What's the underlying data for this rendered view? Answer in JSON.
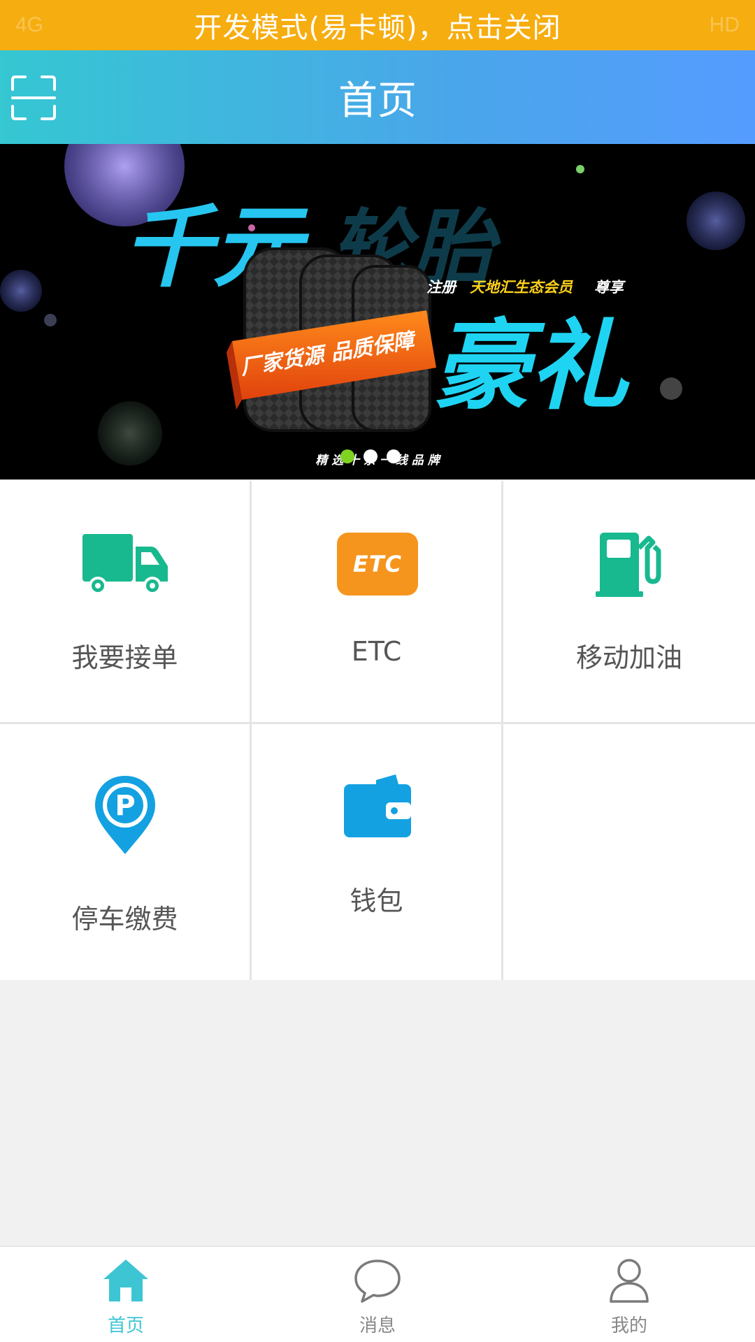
{
  "dev_banner": {
    "message": "开发模式(易卡顿)，点击关闭",
    "status_left": "4G",
    "status_right": "HD"
  },
  "header": {
    "title": "首页",
    "scan_icon": "scan-icon"
  },
  "banner": {
    "headline_a": "千元",
    "headline_b": "轮胎",
    "headline_c": "豪礼",
    "promo_prefix": "注册",
    "promo_highlight": "天地汇生态会员",
    "promo_suffix": "尊享",
    "ribbon_text": "厂家货源  品质保障",
    "footer_text": "精  选  十  余  一  线  品  牌",
    "carousel": {
      "count": 3,
      "active_index": 0,
      "active_color": "#7ed321",
      "dot_color": "#ffffff"
    }
  },
  "services": [
    {
      "label": "我要接单",
      "icon": "truck-icon",
      "color": "#18b98e"
    },
    {
      "label": "ETC",
      "icon": "etc-icon",
      "color": "#f5951d",
      "badge": "ETC"
    },
    {
      "label": "移动加油",
      "icon": "fuel-pump-icon",
      "color": "#18b98e"
    },
    {
      "label": "停车缴费",
      "icon": "parking-pin-icon",
      "color": "#13a1e2",
      "badge": "P"
    },
    {
      "label": "钱包",
      "icon": "wallet-icon",
      "color": "#13a1e2"
    }
  ],
  "tabbar": {
    "active_color": "#3ec5d4",
    "items": [
      {
        "label": "首页",
        "icon": "home-icon",
        "active": true
      },
      {
        "label": "消息",
        "icon": "chat-bubble-icon",
        "active": false
      },
      {
        "label": "我的",
        "icon": "user-icon",
        "active": false
      }
    ]
  }
}
